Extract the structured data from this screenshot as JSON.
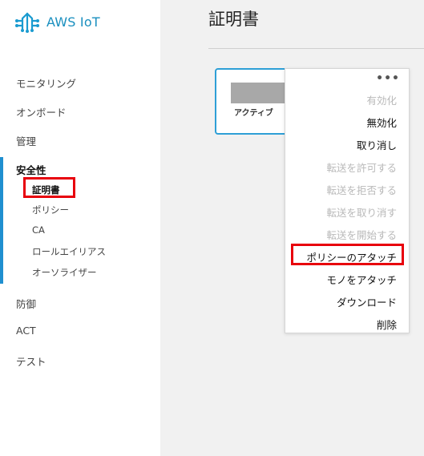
{
  "app": {
    "logo_text": "AWS IoT"
  },
  "sidebar": {
    "items": [
      {
        "label": "モニタリング"
      },
      {
        "label": "オンボード"
      },
      {
        "label": "管理"
      },
      {
        "label": "安全性"
      },
      {
        "label": "防御"
      },
      {
        "label": "ACT"
      },
      {
        "label": "テスト"
      }
    ],
    "sub_items": [
      {
        "label": "証明書"
      },
      {
        "label": "ポリシー"
      },
      {
        "label": "CA"
      },
      {
        "label": "ロールエイリアス"
      },
      {
        "label": "オーソライザー"
      }
    ],
    "accent_color": "#1f8fd0"
  },
  "main": {
    "title": "証明書",
    "card": {
      "status": "アクティブ",
      "border_color": "#2e9fd6"
    }
  },
  "menu": {
    "more_icon": "•••",
    "items": [
      {
        "label": "有効化",
        "enabled": false
      },
      {
        "label": "無効化",
        "enabled": true
      },
      {
        "label": "取り消し",
        "enabled": true
      },
      {
        "label": "転送を許可する",
        "enabled": false
      },
      {
        "label": "転送を拒否する",
        "enabled": false
      },
      {
        "label": "転送を取り消す",
        "enabled": false
      },
      {
        "label": "転送を開始する",
        "enabled": false
      },
      {
        "label": "ポリシーのアタッチ",
        "enabled": true
      },
      {
        "label": "モノをアタッチ",
        "enabled": true
      },
      {
        "label": "ダウンロード",
        "enabled": true
      },
      {
        "label": "削除",
        "enabled": true
      }
    ]
  },
  "highlight_color": "#e8000c"
}
